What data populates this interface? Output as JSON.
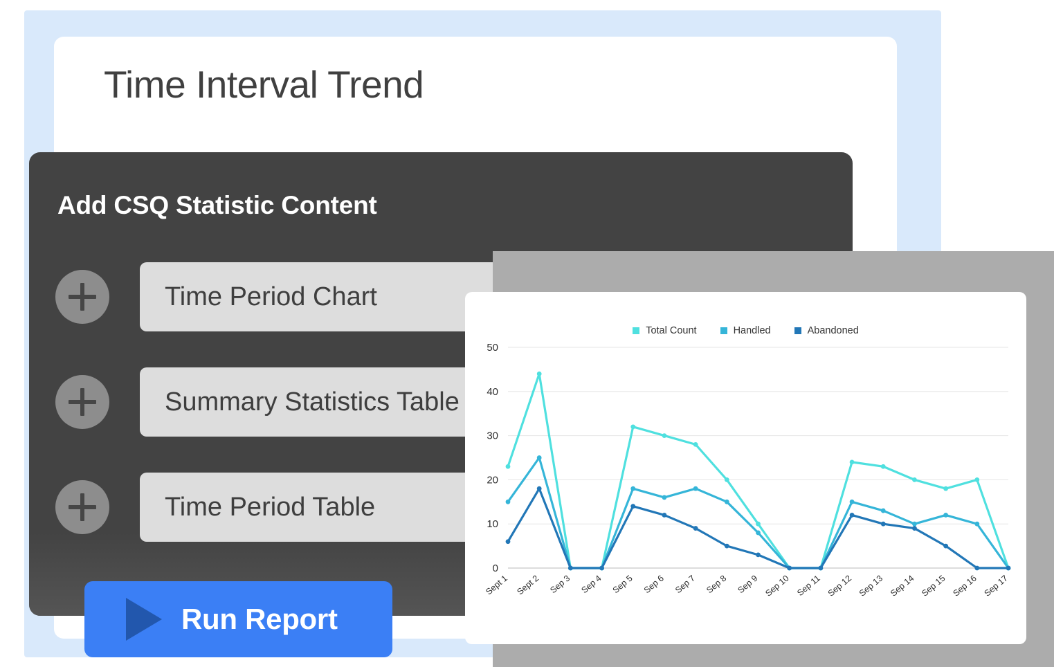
{
  "page_title": "Time Interval Trend",
  "panel": {
    "heading": "Add CSQ Statistic Content",
    "items": [
      {
        "label": "Time Period Chart",
        "add_icon": "plus-icon"
      },
      {
        "label": "Summary Statistics Table",
        "add_icon": "plus-icon"
      },
      {
        "label": "Time Period Table",
        "add_icon": "plus-icon"
      }
    ],
    "run_button": {
      "label": "Run Report",
      "icon": "play-icon"
    }
  },
  "colors": {
    "page_backdrop": "#d9e9fb",
    "dark_panel": "#434343",
    "row_pill": "#dddddd",
    "plus_circle": "#8d8d8d",
    "run_button": "#3b7ff5",
    "run_button_icon": "#2257ad",
    "gray_backdrop": "#acacac",
    "total_count": "#4fe0df",
    "handled": "#35b5d8",
    "abandoned": "#2277b7"
  },
  "chart_data": {
    "type": "line",
    "title": "",
    "xlabel": "",
    "ylabel": "",
    "ylim": [
      0,
      50
    ],
    "yticks": [
      0,
      10,
      20,
      30,
      40,
      50
    ],
    "grid": true,
    "legend_position": "top-center",
    "categories": [
      "Sept 1",
      "Sept 2",
      "Sep 3",
      "Sep 4",
      "Sep 5",
      "Sep 6",
      "Sep 7",
      "Sep 8",
      "Sep 9",
      "Sep 10",
      "Sep 11",
      "Sep 12",
      "Sep 13",
      "Sep 14",
      "Sep 15",
      "Sep 16",
      "Sep 17"
    ],
    "series": [
      {
        "name": "Total Count",
        "color": "#4fe0df",
        "values": [
          23,
          44,
          0,
          0,
          32,
          30,
          28,
          20,
          10,
          0,
          0,
          24,
          23,
          20,
          18,
          20,
          0
        ]
      },
      {
        "name": "Handled",
        "color": "#35b5d8",
        "values": [
          15,
          25,
          0,
          0,
          18,
          16,
          18,
          15,
          8,
          0,
          0,
          15,
          13,
          10,
          12,
          10,
          0
        ]
      },
      {
        "name": "Abandoned",
        "color": "#2277b7",
        "values": [
          6,
          18,
          0,
          0,
          14,
          12,
          9,
          5,
          3,
          0,
          0,
          12,
          10,
          9,
          5,
          0,
          0
        ]
      }
    ]
  }
}
